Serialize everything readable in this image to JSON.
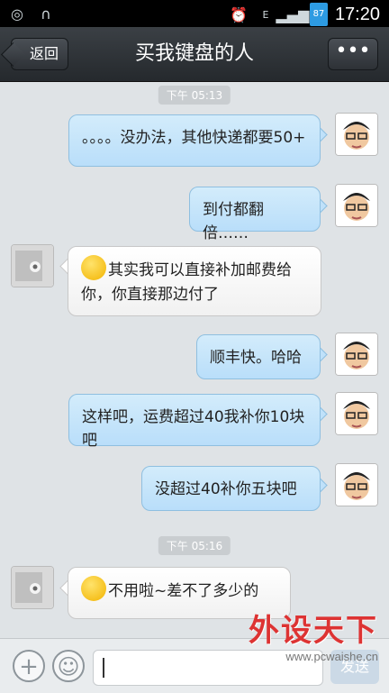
{
  "status_bar": {
    "time": "17:20",
    "battery": "87"
  },
  "header": {
    "back_label": "返回",
    "title": "买我键盘的人",
    "more_label": "•••"
  },
  "timestamps": [
    "下午 05:13",
    "下午 05:16"
  ],
  "messages": [
    {
      "side": "out",
      "text": "。。。。没办法，其他快递都要50+"
    },
    {
      "side": "out",
      "text": "到付都翻倍……"
    },
    {
      "side": "in",
      "text": "其实我可以直接补加邮费给你，你直接那边付了",
      "emoji": true
    },
    {
      "side": "out",
      "text": "顺丰快。哈哈"
    },
    {
      "side": "out",
      "text": "这样吧，运费超过40我补你10块吧"
    },
    {
      "side": "out",
      "text": "没超过40补你五块吧"
    },
    {
      "side": "in",
      "text": "不用啦~差不了多少的",
      "emoji": true
    }
  ],
  "input_bar": {
    "plus_label": "+",
    "emoji_label": "☺",
    "input_value": "",
    "send_label": "发送"
  },
  "watermark": {
    "title": "外设天下",
    "url": "www.pcwaishe.cn"
  }
}
